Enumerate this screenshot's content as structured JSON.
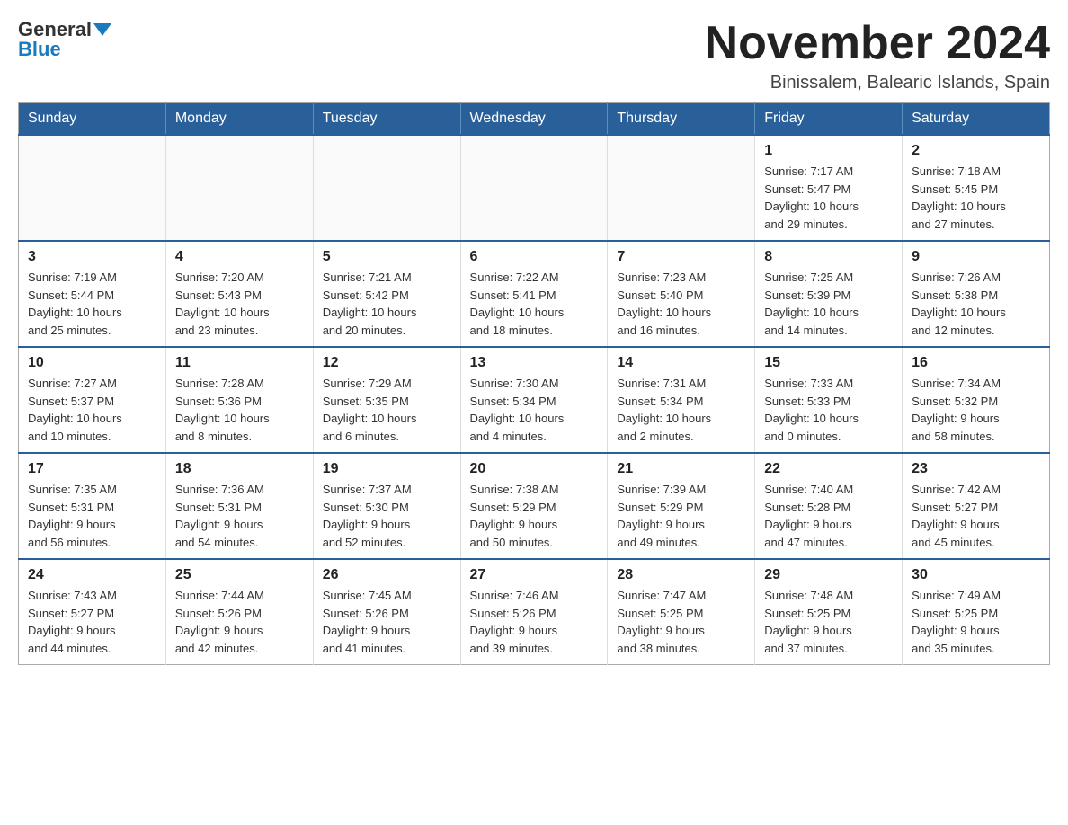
{
  "header": {
    "logo_general": "General",
    "logo_blue": "Blue",
    "month_title": "November 2024",
    "location": "Binissalem, Balearic Islands, Spain"
  },
  "weekdays": [
    "Sunday",
    "Monday",
    "Tuesday",
    "Wednesday",
    "Thursday",
    "Friday",
    "Saturday"
  ],
  "weeks": [
    [
      {
        "day": "",
        "info": ""
      },
      {
        "day": "",
        "info": ""
      },
      {
        "day": "",
        "info": ""
      },
      {
        "day": "",
        "info": ""
      },
      {
        "day": "",
        "info": ""
      },
      {
        "day": "1",
        "info": "Sunrise: 7:17 AM\nSunset: 5:47 PM\nDaylight: 10 hours\nand 29 minutes."
      },
      {
        "day": "2",
        "info": "Sunrise: 7:18 AM\nSunset: 5:45 PM\nDaylight: 10 hours\nand 27 minutes."
      }
    ],
    [
      {
        "day": "3",
        "info": "Sunrise: 7:19 AM\nSunset: 5:44 PM\nDaylight: 10 hours\nand 25 minutes."
      },
      {
        "day": "4",
        "info": "Sunrise: 7:20 AM\nSunset: 5:43 PM\nDaylight: 10 hours\nand 23 minutes."
      },
      {
        "day": "5",
        "info": "Sunrise: 7:21 AM\nSunset: 5:42 PM\nDaylight: 10 hours\nand 20 minutes."
      },
      {
        "day": "6",
        "info": "Sunrise: 7:22 AM\nSunset: 5:41 PM\nDaylight: 10 hours\nand 18 minutes."
      },
      {
        "day": "7",
        "info": "Sunrise: 7:23 AM\nSunset: 5:40 PM\nDaylight: 10 hours\nand 16 minutes."
      },
      {
        "day": "8",
        "info": "Sunrise: 7:25 AM\nSunset: 5:39 PM\nDaylight: 10 hours\nand 14 minutes."
      },
      {
        "day": "9",
        "info": "Sunrise: 7:26 AM\nSunset: 5:38 PM\nDaylight: 10 hours\nand 12 minutes."
      }
    ],
    [
      {
        "day": "10",
        "info": "Sunrise: 7:27 AM\nSunset: 5:37 PM\nDaylight: 10 hours\nand 10 minutes."
      },
      {
        "day": "11",
        "info": "Sunrise: 7:28 AM\nSunset: 5:36 PM\nDaylight: 10 hours\nand 8 minutes."
      },
      {
        "day": "12",
        "info": "Sunrise: 7:29 AM\nSunset: 5:35 PM\nDaylight: 10 hours\nand 6 minutes."
      },
      {
        "day": "13",
        "info": "Sunrise: 7:30 AM\nSunset: 5:34 PM\nDaylight: 10 hours\nand 4 minutes."
      },
      {
        "day": "14",
        "info": "Sunrise: 7:31 AM\nSunset: 5:34 PM\nDaylight: 10 hours\nand 2 minutes."
      },
      {
        "day": "15",
        "info": "Sunrise: 7:33 AM\nSunset: 5:33 PM\nDaylight: 10 hours\nand 0 minutes."
      },
      {
        "day": "16",
        "info": "Sunrise: 7:34 AM\nSunset: 5:32 PM\nDaylight: 9 hours\nand 58 minutes."
      }
    ],
    [
      {
        "day": "17",
        "info": "Sunrise: 7:35 AM\nSunset: 5:31 PM\nDaylight: 9 hours\nand 56 minutes."
      },
      {
        "day": "18",
        "info": "Sunrise: 7:36 AM\nSunset: 5:31 PM\nDaylight: 9 hours\nand 54 minutes."
      },
      {
        "day": "19",
        "info": "Sunrise: 7:37 AM\nSunset: 5:30 PM\nDaylight: 9 hours\nand 52 minutes."
      },
      {
        "day": "20",
        "info": "Sunrise: 7:38 AM\nSunset: 5:29 PM\nDaylight: 9 hours\nand 50 minutes."
      },
      {
        "day": "21",
        "info": "Sunrise: 7:39 AM\nSunset: 5:29 PM\nDaylight: 9 hours\nand 49 minutes."
      },
      {
        "day": "22",
        "info": "Sunrise: 7:40 AM\nSunset: 5:28 PM\nDaylight: 9 hours\nand 47 minutes."
      },
      {
        "day": "23",
        "info": "Sunrise: 7:42 AM\nSunset: 5:27 PM\nDaylight: 9 hours\nand 45 minutes."
      }
    ],
    [
      {
        "day": "24",
        "info": "Sunrise: 7:43 AM\nSunset: 5:27 PM\nDaylight: 9 hours\nand 44 minutes."
      },
      {
        "day": "25",
        "info": "Sunrise: 7:44 AM\nSunset: 5:26 PM\nDaylight: 9 hours\nand 42 minutes."
      },
      {
        "day": "26",
        "info": "Sunrise: 7:45 AM\nSunset: 5:26 PM\nDaylight: 9 hours\nand 41 minutes."
      },
      {
        "day": "27",
        "info": "Sunrise: 7:46 AM\nSunset: 5:26 PM\nDaylight: 9 hours\nand 39 minutes."
      },
      {
        "day": "28",
        "info": "Sunrise: 7:47 AM\nSunset: 5:25 PM\nDaylight: 9 hours\nand 38 minutes."
      },
      {
        "day": "29",
        "info": "Sunrise: 7:48 AM\nSunset: 5:25 PM\nDaylight: 9 hours\nand 37 minutes."
      },
      {
        "day": "30",
        "info": "Sunrise: 7:49 AM\nSunset: 5:25 PM\nDaylight: 9 hours\nand 35 minutes."
      }
    ]
  ]
}
